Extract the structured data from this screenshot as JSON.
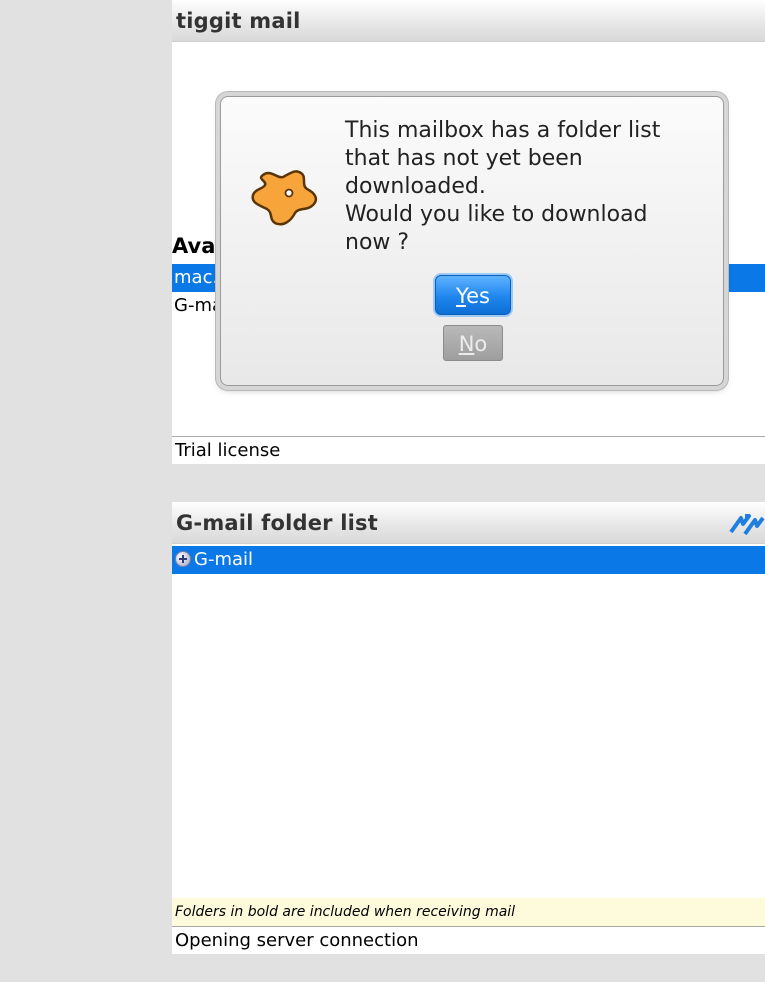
{
  "main_screen": {
    "title": "tiggit mail",
    "accounts_heading_visible": "Avai",
    "accounts": [
      {
        "label": "mac.",
        "selected": true
      },
      {
        "label": "G-ma",
        "selected": false
      }
    ],
    "license_status": "Trial license"
  },
  "dialog": {
    "message_lines": [
      "This mailbox has a folder list",
      "that has not yet been",
      "downloaded.",
      "Would you like to download",
      "now ?"
    ],
    "yes_accel": "Y",
    "yes_rest": "es",
    "no_accel": "N",
    "no_rest": "o",
    "icon": "orange-splat-icon"
  },
  "folder_screen": {
    "title": "G-mail folder list",
    "sync_icon": "refresh-arrows-icon",
    "folders": [
      {
        "label": "G-mail",
        "selected": true,
        "expandable": true
      }
    ],
    "hint": "Folders in bold are included when receiving mail",
    "status": "Opening server connection"
  },
  "colors": {
    "selection": "#0a78e6",
    "hint_background": "#fdfbdc",
    "accent_orange": "#f7a43a"
  }
}
